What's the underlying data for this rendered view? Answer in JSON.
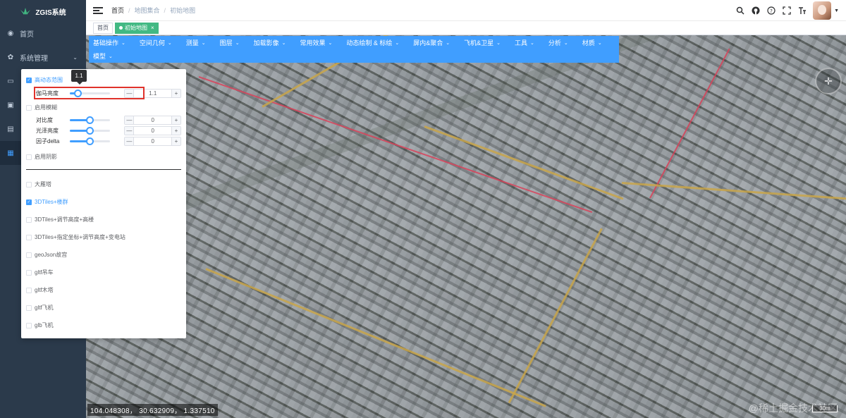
{
  "app": {
    "title": "ZGIS系统"
  },
  "sidebar": {
    "items": [
      {
        "label": "首页",
        "icon": "dashboard-icon"
      },
      {
        "label": "系统管理",
        "icon": "gear-icon",
        "expanded": false
      }
    ]
  },
  "header": {
    "breadcrumb": [
      "首页",
      "地图集合",
      "初始地图"
    ]
  },
  "tags": [
    {
      "label": "首页",
      "active": false
    },
    {
      "label": "初始地图",
      "active": true
    }
  ],
  "toolbar": {
    "items": [
      "基础操作",
      "空间几何",
      "测量",
      "图层",
      "加载影像",
      "常用效果",
      "动态绘制 & 标绘",
      "屏内&聚合",
      "飞机&卫星",
      "工具",
      "分析",
      "材质",
      "模型"
    ]
  },
  "panel": {
    "hdr": {
      "label": "高动态范围",
      "checked": true
    },
    "gamma": {
      "label": "伽马亮度",
      "value": "1.1",
      "fraction": 0.2
    },
    "tooltip": "1.1",
    "blur": {
      "label": "启用模糊",
      "checked": false
    },
    "contrast": {
      "label": "对比度",
      "value": "0",
      "fraction": 0.5
    },
    "gloss": {
      "label": "光泽亮度",
      "value": "0",
      "fraction": 0.5
    },
    "delta": {
      "label": "因子delta",
      "value": "0",
      "fraction": 0.5
    },
    "shadow": {
      "label": "启用阴影",
      "checked": false
    },
    "layers": [
      {
        "label": "大雁塔",
        "checked": false
      },
      {
        "label": "3DTiles+楼群",
        "checked": true
      },
      {
        "label": "3DTiles+调节高度+高楼",
        "checked": false
      },
      {
        "label": "3DTiles+指定坐标+调节高度+变电站",
        "checked": false
      },
      {
        "label": "geoJson故宫",
        "checked": false
      },
      {
        "label": "gltf吊车",
        "checked": false
      },
      {
        "label": "gltf木塔",
        "checked": false
      },
      {
        "label": "gltf飞机",
        "checked": false
      },
      {
        "label": "glb飞机",
        "checked": false
      }
    ]
  },
  "map": {
    "coords": "104.048308， 30.632909， 1.337510",
    "scale": "30m",
    "watermark": "@稀土掘金技术社区"
  },
  "colors": {
    "primary": "#409eff",
    "sidebar": "#2b3a4b",
    "tag_active": "#42b983",
    "highlight": "#e0322b"
  }
}
